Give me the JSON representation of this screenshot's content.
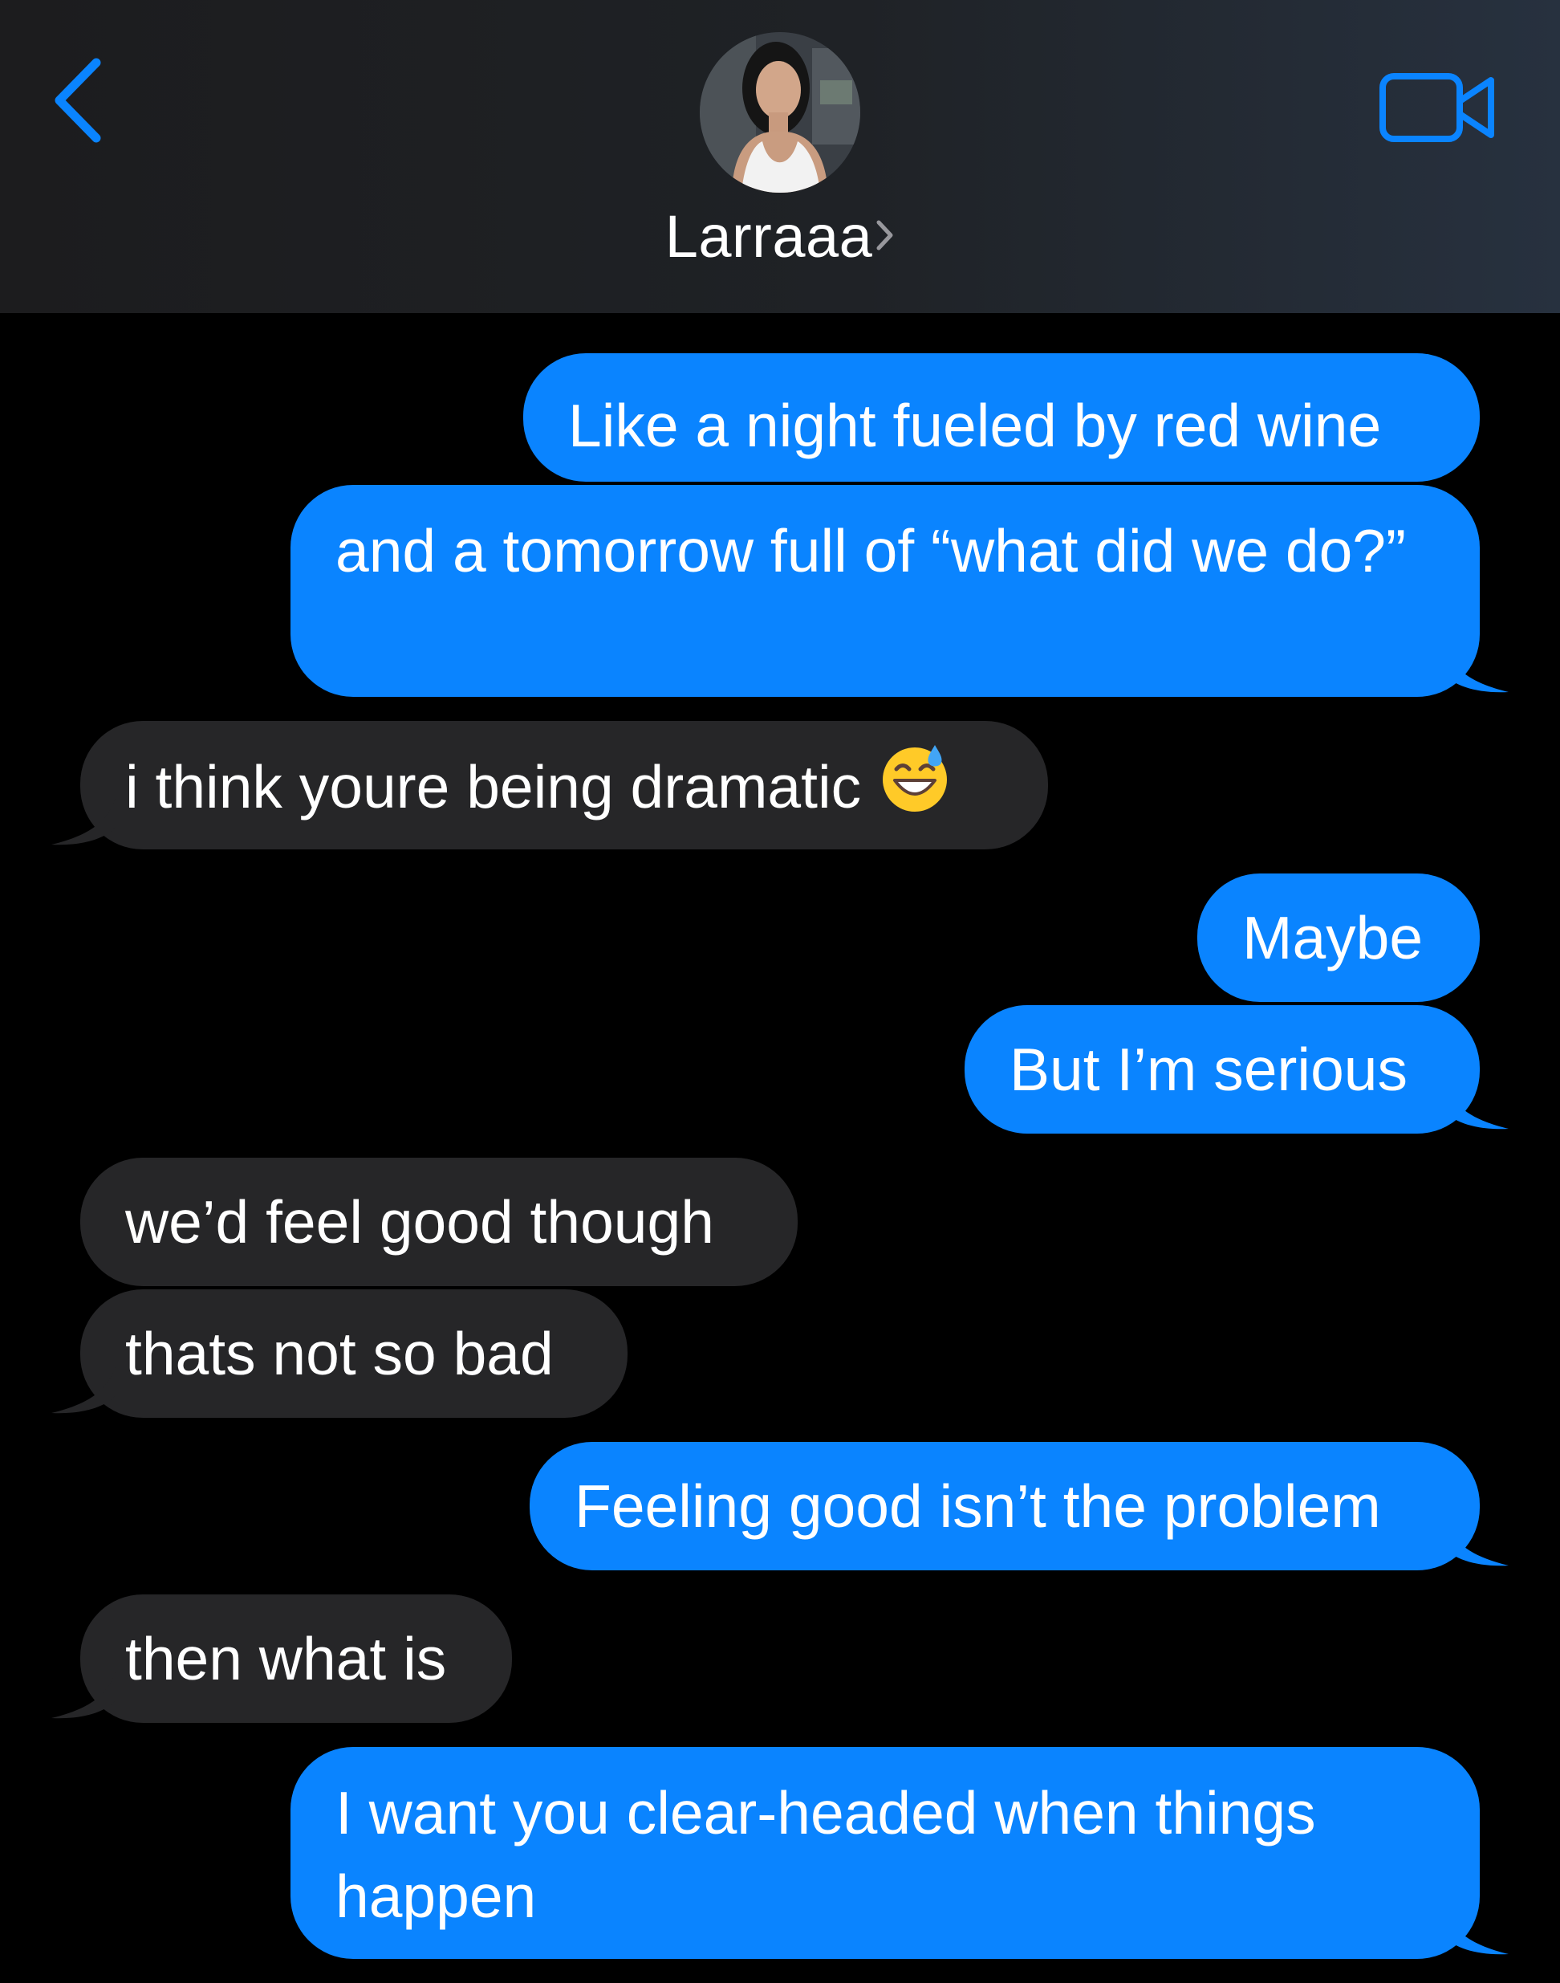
{
  "header": {
    "back_icon": "chevron-left-icon",
    "contact_name": "Larraaa",
    "name_chevron_icon": "chevron-right-icon",
    "video_icon": "video-camera-icon",
    "accent_color": "#0a84ff"
  },
  "conversation": {
    "sent_color": "#0a84ff",
    "received_color": "#262628",
    "messages": [
      {
        "direction": "sent",
        "text": "Like a night fueled by red wine"
      },
      {
        "direction": "sent",
        "text": "and a tomorrow full of “what did we do?”"
      },
      {
        "direction": "received",
        "text": "i think youre being dramatic",
        "emoji": "grinning-face-with-sweat-icon"
      },
      {
        "direction": "sent",
        "text": "Maybe"
      },
      {
        "direction": "sent",
        "text": "But I’m serious"
      },
      {
        "direction": "received",
        "text": "we’d feel good though"
      },
      {
        "direction": "received",
        "text": "thats not so bad"
      },
      {
        "direction": "sent",
        "text": "Feeling good isn’t the problem"
      },
      {
        "direction": "received",
        "text": "then what is"
      },
      {
        "direction": "sent",
        "text": "I want you clear-headed when things happen"
      }
    ]
  }
}
